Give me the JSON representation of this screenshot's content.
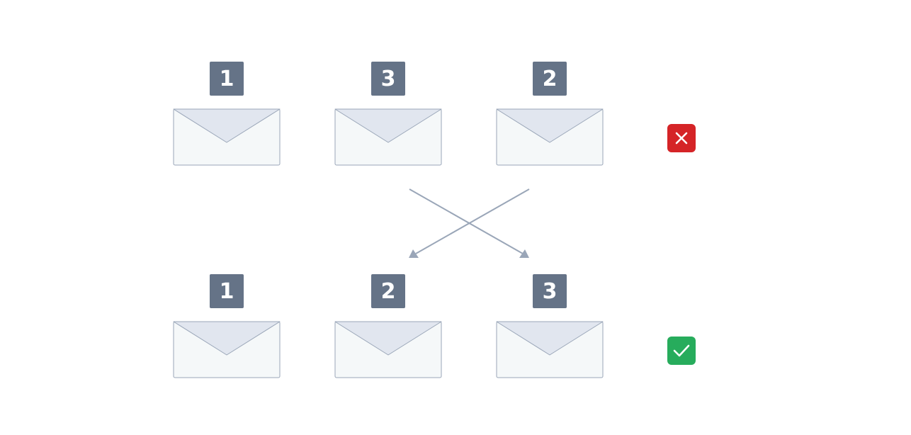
{
  "colors": {
    "badge": "#657387",
    "envelope_body": "#f5f8f9",
    "envelope_flap": "#e1e6ef",
    "envelope_stroke": "#9aa6b8",
    "arrow": "#9aa6b8",
    "wrong": "#d52427",
    "right": "#27ac5c"
  },
  "rows": [
    {
      "name": "top",
      "status": "wrong",
      "status_icon": "x-icon",
      "items": [
        {
          "number": "1"
        },
        {
          "number": "3"
        },
        {
          "number": "2"
        }
      ]
    },
    {
      "name": "bottom",
      "status": "right",
      "status_icon": "check-icon",
      "items": [
        {
          "number": "1"
        },
        {
          "number": "2"
        },
        {
          "number": "3"
        }
      ]
    }
  ]
}
